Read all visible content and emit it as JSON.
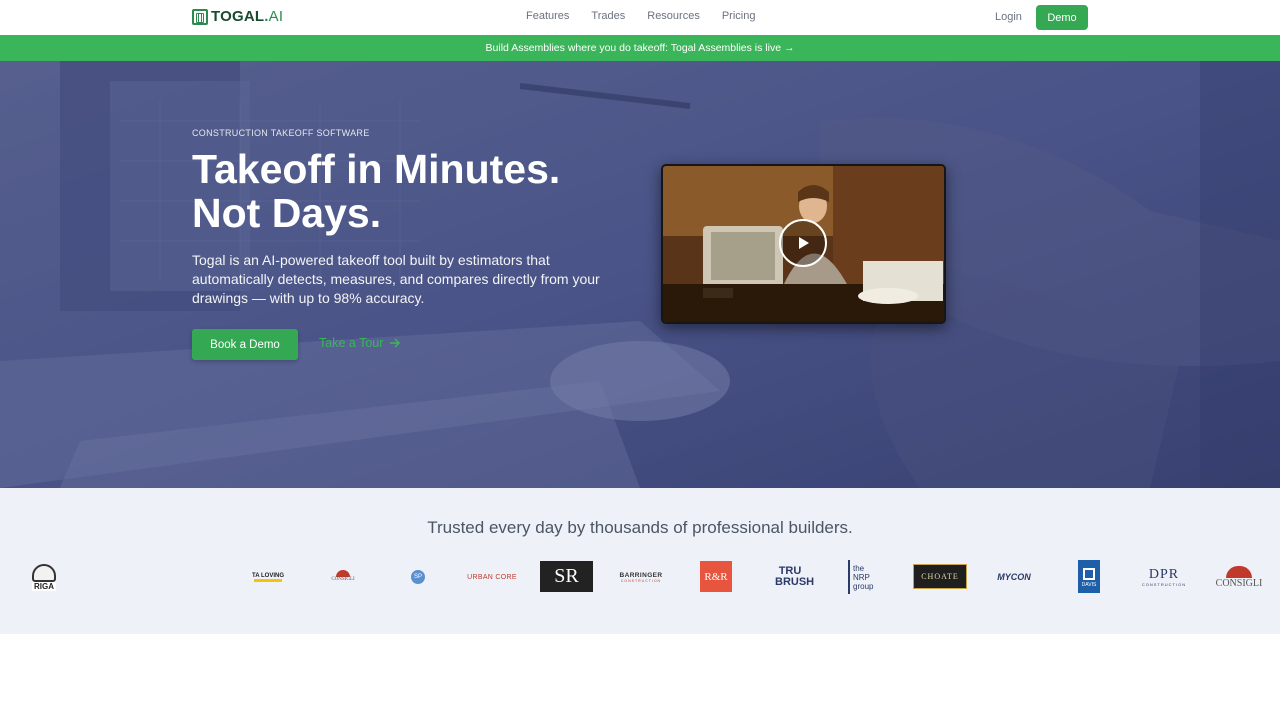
{
  "nav": {
    "logo_text": "TOGAL",
    "logo_dot": ".",
    "logo_ai": "AI",
    "links": [
      "Features",
      "Trades",
      "Resources",
      "Pricing"
    ],
    "login": "Login",
    "demo": "Demo"
  },
  "banner": {
    "text": "Build Assemblies where you do takeoff: Togal Assemblies is live →"
  },
  "hero": {
    "eyebrow": "CONSTRUCTION TAKEOFF SOFTWARE",
    "headline_line1": "Takeoff in Minutes.",
    "headline_line2": "Not Days.",
    "subtext": "Togal is an AI-powered takeoff tool built by estimators that automatically detects, measures, and compares directly from your drawings — with up to 98% accuracy.",
    "cta_primary": "Book a Demo",
    "cta_secondary": "Take a Tour"
  },
  "trust": {
    "title": "Trusted every day by thousands of professional builders.",
    "logos": [
      {
        "name": "RIGA"
      },
      {
        "name": "TA LOVING"
      },
      {
        "name": "CONSIGLI"
      },
      {
        "name": "SP"
      },
      {
        "name": "URBAN CORE"
      },
      {
        "name": "SR"
      },
      {
        "name": "BARRINGER",
        "sub": "CONSTRUCTION"
      },
      {
        "name": "R&R"
      },
      {
        "name": "TRU BRUSH"
      },
      {
        "name": "the NRP group"
      },
      {
        "name": "CHOATE"
      },
      {
        "name": "MYCON"
      },
      {
        "name": "DAVIS"
      },
      {
        "name": "DPR",
        "sub": "CONSTRUCTION"
      },
      {
        "name": "CONSIGLI"
      }
    ]
  },
  "colors": {
    "brand_green": "#34a853",
    "banner_green": "#3bb55a",
    "hero_overlay": "#4a5688",
    "trust_bg": "#eef2f8"
  }
}
